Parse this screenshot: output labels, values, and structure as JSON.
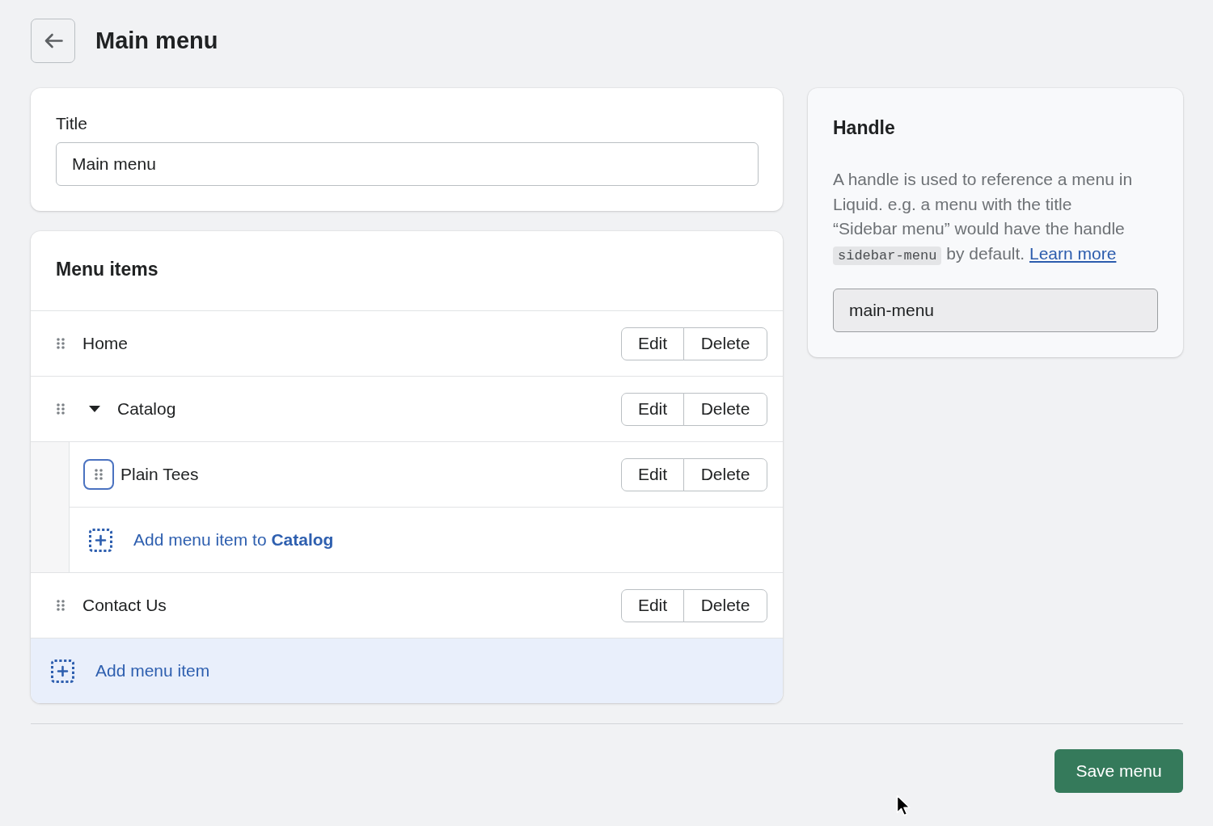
{
  "header": {
    "title": "Main menu"
  },
  "title_card": {
    "label": "Title",
    "value": "Main menu"
  },
  "menu_card": {
    "heading": "Menu items",
    "items": [
      {
        "label": "Home",
        "focused": false,
        "actions": [
          "Edit",
          "Delete"
        ]
      },
      {
        "label": "Catalog",
        "focused": false,
        "expanded": true,
        "actions": [
          "Edit",
          "Delete"
        ],
        "children": [
          {
            "label": "Plain Tees",
            "focused": true,
            "actions": [
              "Edit",
              "Delete"
            ]
          }
        ],
        "add_child": "Add menu item to **Catalog**"
      },
      {
        "label": "Contact Us",
        "focused": false,
        "actions": [
          "Edit",
          "Delete"
        ]
      }
    ],
    "add_item": "Add menu item"
  },
  "handle_card": {
    "heading": "Handle",
    "description": "A handle is used to reference a menu in Liquid. e.g. a menu with the title “Sidebar menu” would have the handle",
    "code": "sidebar-menu",
    "description_end": "by default.",
    "link": "Learn more",
    "value": "main-menu"
  },
  "footer": {
    "save_button": "Save menu"
  }
}
